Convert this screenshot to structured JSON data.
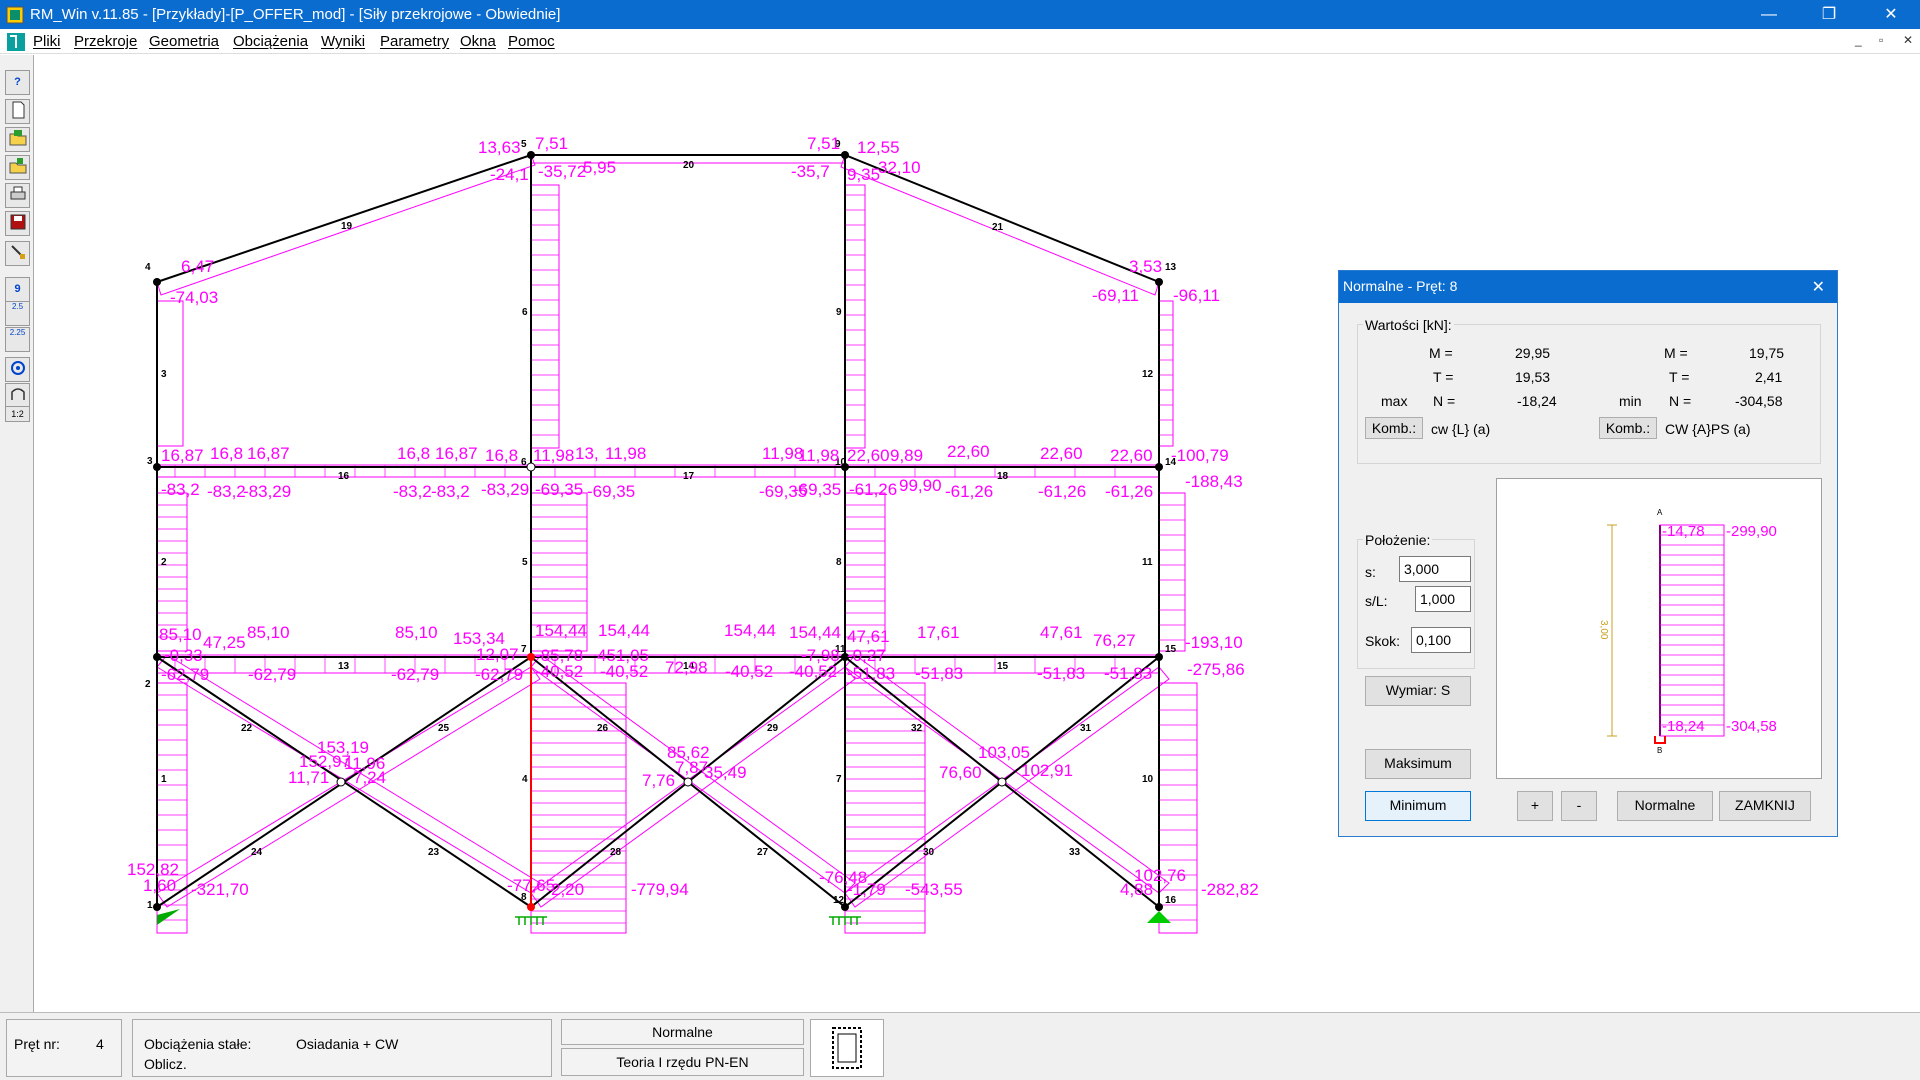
{
  "app": {
    "title": "RM_Win v.11.85 - [Przykłady]-[P_OFFER_mod] - [Siły przekrojowe - Obwiednie]",
    "window_controls": {
      "minimize": "—",
      "maximize": "❐",
      "close": "✕"
    },
    "mdi_controls": {
      "minimize": "_",
      "restore": "▫",
      "close": "✕"
    }
  },
  "menu": [
    "Pliki",
    "Przekroje",
    "Geometria",
    "Obciążenia",
    "Wyniki",
    "Parametry",
    "Okna",
    "Pomoc"
  ],
  "toolbar": {
    "buttons": [
      "help-icon",
      "new-file-icon",
      "open-file-icon",
      "open-folder-icon",
      "print-icon",
      "save-icon",
      "brush-icon"
    ],
    "glyphs": {
      "help": "?",
      "number_tool": "9",
      "scale_label_a": "2.5",
      "scale_label_b": "2.25",
      "ratio_tool": "1:2"
    }
  },
  "frame": {
    "node_numbers": [
      "1",
      "2",
      "3",
      "4",
      "5",
      "6",
      "7",
      "8",
      "9",
      "10",
      "11",
      "12",
      "13",
      "14",
      "15",
      "16"
    ],
    "bar_numbers": [
      "1",
      "2",
      "3",
      "4",
      "5",
      "6",
      "7",
      "8",
      "9",
      "10",
      "11",
      "12",
      "13",
      "14",
      "15",
      "16",
      "17",
      "18",
      "19",
      "20",
      "21",
      "22",
      "23",
      "24",
      "25",
      "26",
      "27",
      "28",
      "29",
      "30",
      "31",
      "32",
      "33"
    ],
    "result_labels": [
      "13,63",
      "7,51",
      "7,51",
      "12,55",
      "-24,1",
      "-35,72",
      "5,95",
      "-35,7",
      "9,35",
      "32,10",
      "6,47",
      "-74,03",
      "3,53",
      "-69,11",
      "-96,11",
      "16,87",
      "16,8",
      "16,87",
      "16,8",
      "16,87",
      "16,8",
      "11,98",
      "13,",
      "11,98",
      "11,98",
      "11,98",
      "22,60",
      "9,89",
      "22,60",
      "22,60",
      "22,60",
      "-100,79",
      "-83,2",
      "-83,2",
      "-83,29",
      "-83,2",
      "-83,2",
      "-83,29",
      "-69,35",
      "-69,35",
      "-69,35",
      "-69,35",
      "-61,26",
      "99,90",
      "-61,26",
      "-61,26",
      "-61,26",
      "-188,43",
      "85,10",
      "47,25",
      "85,10",
      "85,10",
      "153,34",
      "154,44",
      "154,44",
      "154,44",
      "154,44",
      "47,61",
      "17,61",
      "47,61",
      "76,27",
      "-193,10",
      "-62,79",
      "-0,33",
      "-62,79",
      "-62,79",
      "-62,79",
      "12,07",
      "-85,78",
      "451,05",
      "-40,52",
      "-40,52",
      "72,98",
      "-40,52",
      "-40,52",
      "-7,98",
      "-0,27",
      "-51,83",
      "-51,83",
      "-51,83",
      "-51,83",
      "-275,86",
      "153,19",
      "152,97",
      "11,71",
      "11,96",
      "7,24",
      "85,62",
      "7,87",
      "7,76",
      "35,49",
      "103,05",
      "76,60",
      "102,91",
      "152,82",
      "1,60",
      "-321,70",
      "-77,65",
      "2,20",
      "-779,94",
      "-76,48",
      "-1,79",
      "-543,55",
      "102,76",
      "4,88",
      "-282,82"
    ]
  },
  "dialog": {
    "title": "Normalne - Pręt: 8",
    "close": "✕",
    "values_group": "Wartości [kN]:",
    "left": {
      "M_label": "M =",
      "M": "29,95",
      "T_label": "T =",
      "T": "19,53",
      "max_label": "max",
      "N_label": "N =",
      "N": "-18,24",
      "komb_button": "Komb.:",
      "komb_value": "cw {L} (a)"
    },
    "right": {
      "M_label": "M =",
      "M": "19,75",
      "T_label": "T =",
      "T": "2,41",
      "min_label": "min",
      "N_label": "N =",
      "N": "-304,58",
      "komb_button": "Komb.:",
      "komb_value": "CW {A}PS (a)"
    },
    "position_group": "Położenie:",
    "s_label": "s:",
    "s_value": "3,000",
    "sl_label": "s/L:",
    "sl_value": "1,000",
    "step_label": "Skok:",
    "step_value": "0,100",
    "buttons": {
      "dimension": "Wymiar: S",
      "maximum": "Maksimum",
      "minimum": "Minimum",
      "plus": "+",
      "minus": "-",
      "normal": "Normalne",
      "close": "ZAMKNIJ"
    },
    "diagram": {
      "length": "3,00",
      "node_a": "A",
      "node_b": "B",
      "top_left": "-14,78",
      "top_right": "-299,90",
      "bottom_left": "-18,24",
      "bottom_right": "-304,58"
    }
  },
  "status": {
    "bar_label": "Pręt nr:",
    "bar_value": "4",
    "loads_label": "Obciążenia stałe:",
    "loads_value": "Osiadania + CW",
    "calc_label": "Oblicz.",
    "mode": "Normalne",
    "theory": "Teoria I rzędu PN-EN"
  },
  "colors": {
    "title_bar": "#0b6ccf",
    "result": "#ff00ff",
    "selected": "#ff0000",
    "support": "#00aa00"
  }
}
